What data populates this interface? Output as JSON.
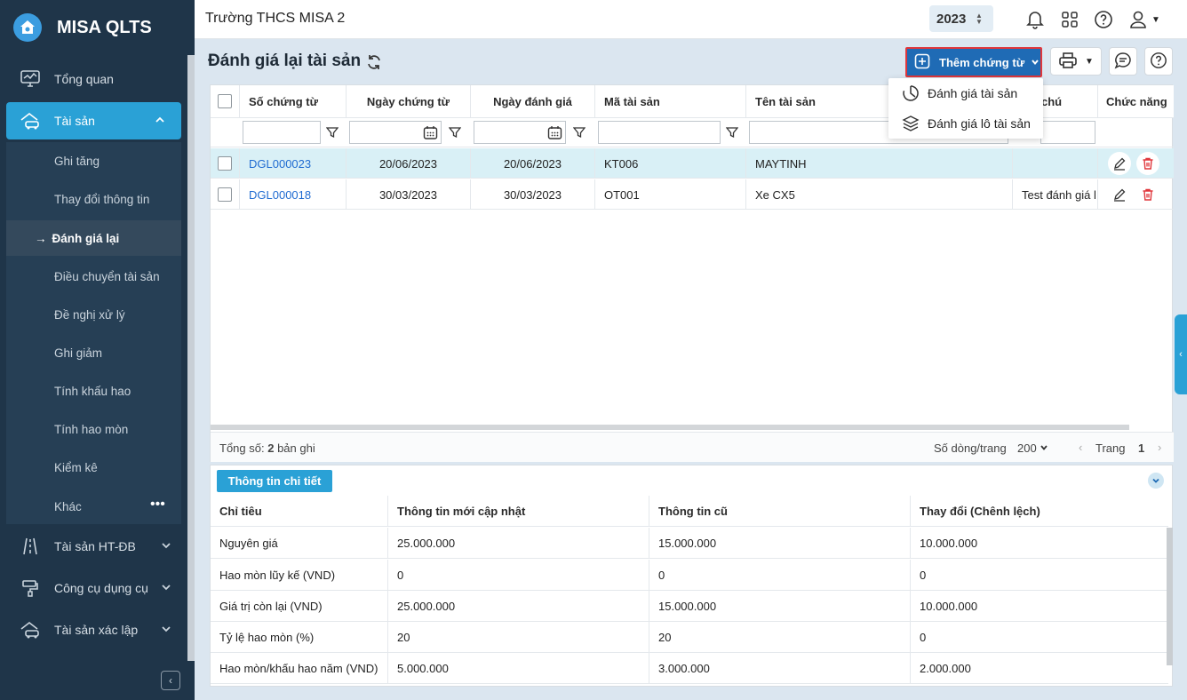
{
  "app": {
    "title": "MISA QLTS"
  },
  "topbar": {
    "org": "Trường THCS MISA 2",
    "year": "2023"
  },
  "sidebar": {
    "items": [
      {
        "label": "Tổng quan"
      },
      {
        "label": "Tài sản"
      },
      {
        "label": "Tài sản HT-ĐB"
      },
      {
        "label": "Công cụ dụng cụ"
      },
      {
        "label": "Tài sản xác lập"
      }
    ],
    "sub": [
      {
        "label": "Ghi tăng"
      },
      {
        "label": "Thay đổi thông tin"
      },
      {
        "label": "Đánh giá lại"
      },
      {
        "label": "Điều chuyển tài sản"
      },
      {
        "label": "Đề nghị xử lý"
      },
      {
        "label": "Ghi giảm"
      },
      {
        "label": "Tính khấu hao"
      },
      {
        "label": "Tính hao mòn"
      },
      {
        "label": "Kiểm kê"
      },
      {
        "label": "Khác"
      }
    ]
  },
  "page": {
    "title": "Đánh giá lại tài sản"
  },
  "toolbar": {
    "add_label": "Thêm chứng từ",
    "menu": [
      "Đánh giá tài sản",
      "Đánh giá lô tài sản"
    ]
  },
  "grid": {
    "columns": [
      "Số chứng từ",
      "Ngày chứng từ",
      "Ngày đánh giá",
      "Mã tài sản",
      "Tên tài sản",
      "chú",
      "Chức năng"
    ],
    "rows": [
      {
        "code": "DGL000023",
        "doc_date": "20/06/2023",
        "eval_date": "20/06/2023",
        "asset_code": "KT006",
        "asset_name": "MAYTINH",
        "note": ""
      },
      {
        "code": "DGL000018",
        "doc_date": "30/03/2023",
        "eval_date": "30/03/2023",
        "asset_code": "OT001",
        "asset_name": "Xe CX5",
        "note": "Test đánh giá l"
      }
    ],
    "footer": {
      "total_label": "Tổng số:",
      "total": "2",
      "total_unit": "bản ghi",
      "per_page_label": "Số dòng/trang",
      "per_page": "200",
      "page_label": "Trang",
      "page": "1"
    }
  },
  "detail": {
    "tab": "Thông tin chi tiết",
    "columns": [
      "Chỉ tiêu",
      "Thông tin mới cập nhật",
      "Thông tin cũ",
      "Thay đổi (Chênh lệch)"
    ],
    "rows": [
      [
        "Nguyên giá",
        "25.000.000",
        "15.000.000",
        "10.000.000"
      ],
      [
        "Hao mòn lũy kế (VND)",
        "0",
        "0",
        "0"
      ],
      [
        "Giá trị còn lại (VND)",
        "25.000.000",
        "15.000.000",
        "10.000.000"
      ],
      [
        "Tỷ lệ hao mòn (%)",
        "20",
        "20",
        "0"
      ],
      [
        "Hao mòn/khấu hao năm (VND)",
        "5.000.000",
        "3.000.000",
        "2.000.000"
      ]
    ]
  },
  "colors": {
    "sidebar": "#1f3549",
    "accent": "#2aa1d6",
    "primary": "#1f6bb5",
    "highlight_border": "#e0363b"
  }
}
